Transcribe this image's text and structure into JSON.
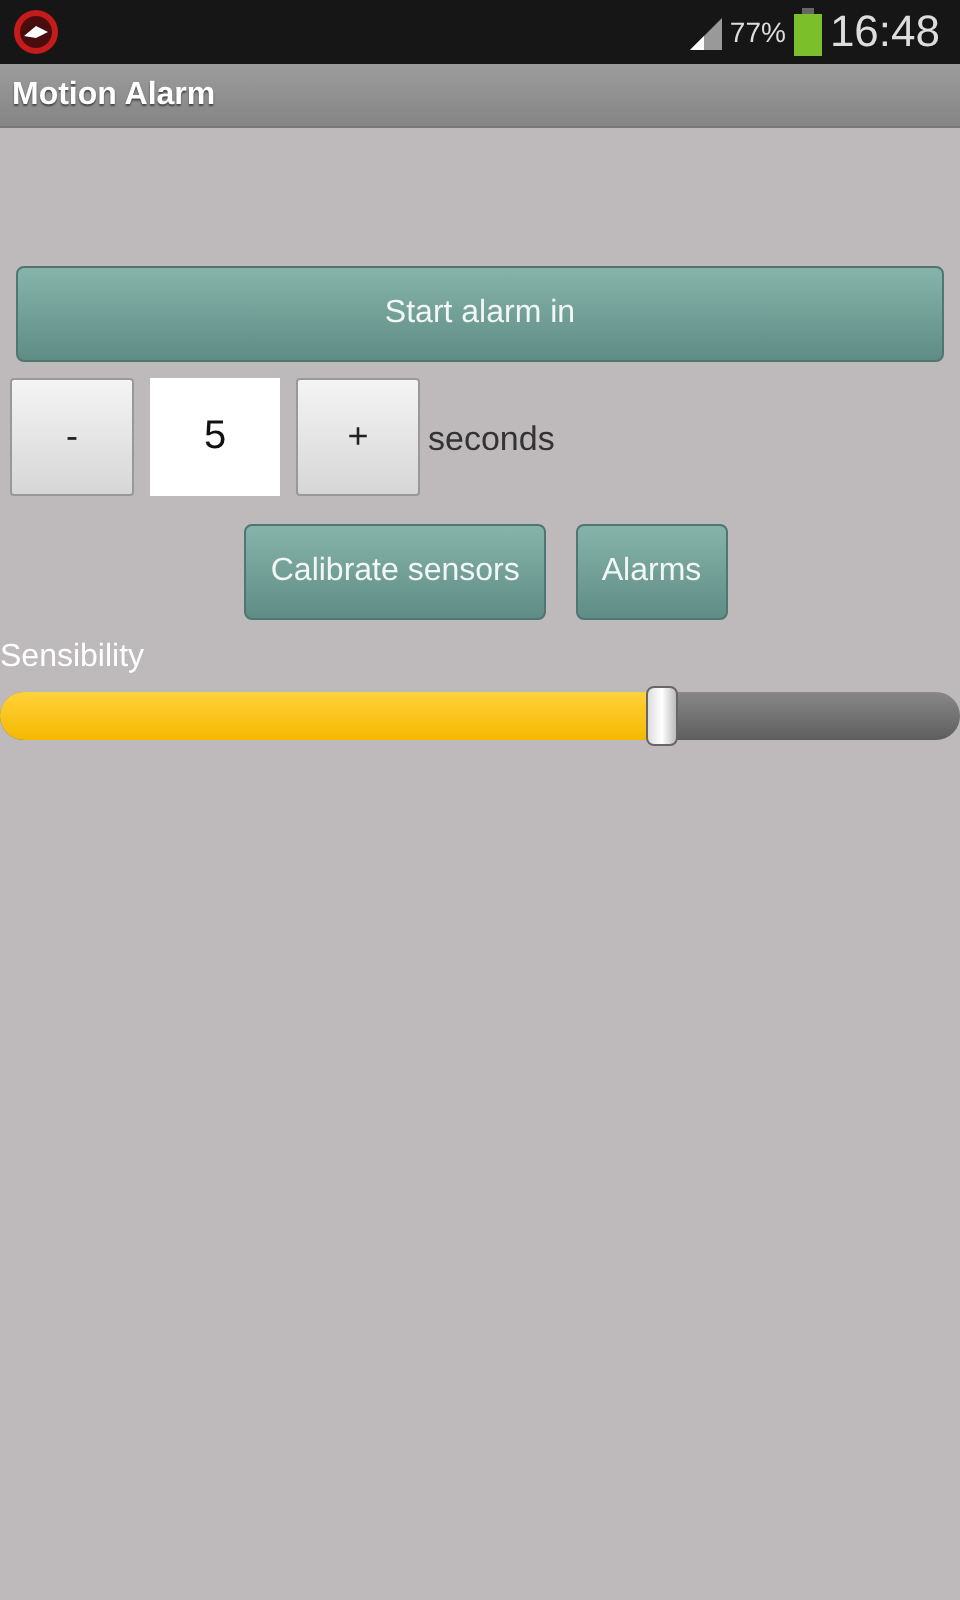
{
  "status_bar": {
    "battery": "77%",
    "time": "16:48"
  },
  "app_bar": {
    "title": "Motion Alarm"
  },
  "start_button": "Start alarm in",
  "delay": {
    "minus": "-",
    "value": "5",
    "plus": "+",
    "unit": "seconds"
  },
  "buttons": [
    "Calibrate sensors",
    "Alarms"
  ],
  "sensibility": {
    "label": "Sensibility",
    "level": 0.69
  }
}
